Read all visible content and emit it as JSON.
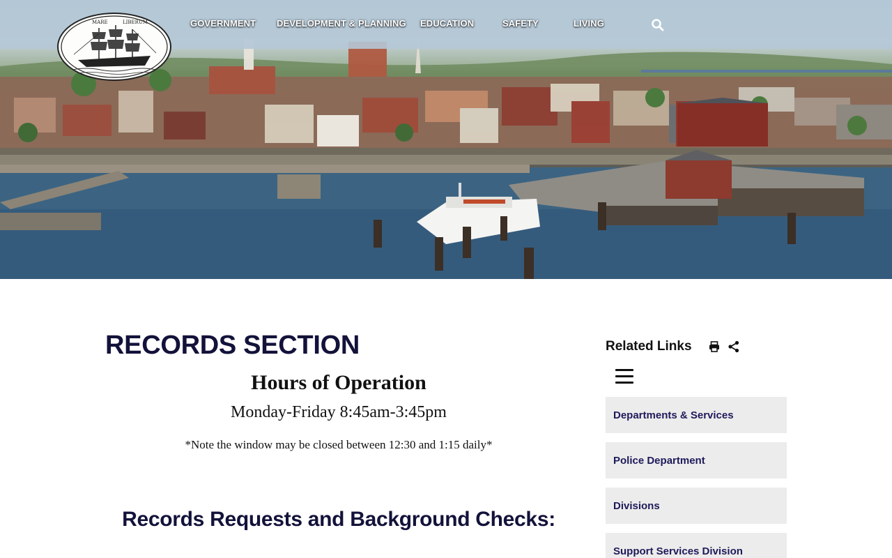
{
  "nav": {
    "items": [
      {
        "label": "GOVERNMENT"
      },
      {
        "label": "DEVELOPMENT & PLANNING"
      },
      {
        "label": "EDUCATION"
      },
      {
        "label": "SAFETY"
      },
      {
        "label": "LIVING"
      }
    ],
    "search_icon": "search-icon"
  },
  "logo": {
    "icon": "ship-seal-logo"
  },
  "main": {
    "title": "RECORDS SECTION",
    "hours_title": "Hours of Operation",
    "hours_line": "Monday-Friday 8:45am-3:45pm",
    "hours_note": "*Note the window may be closed between 12:30 and 1:15 daily*",
    "section_heading": "Records Requests and Background Checks:"
  },
  "sidebar": {
    "title": "Related Links",
    "tools": [
      "print-icon",
      "share-icon"
    ],
    "menu_icon": "hamburger-menu-icon",
    "links": [
      {
        "label": "Departments & Services"
      },
      {
        "label": "Police Department"
      },
      {
        "label": "Divisions"
      },
      {
        "label": "Support Services Division"
      }
    ]
  },
  "colors": {
    "heading": "#13123a",
    "link_text": "#1e1a5a",
    "link_bg": "#ececec",
    "nav_text": "#ffffff"
  }
}
